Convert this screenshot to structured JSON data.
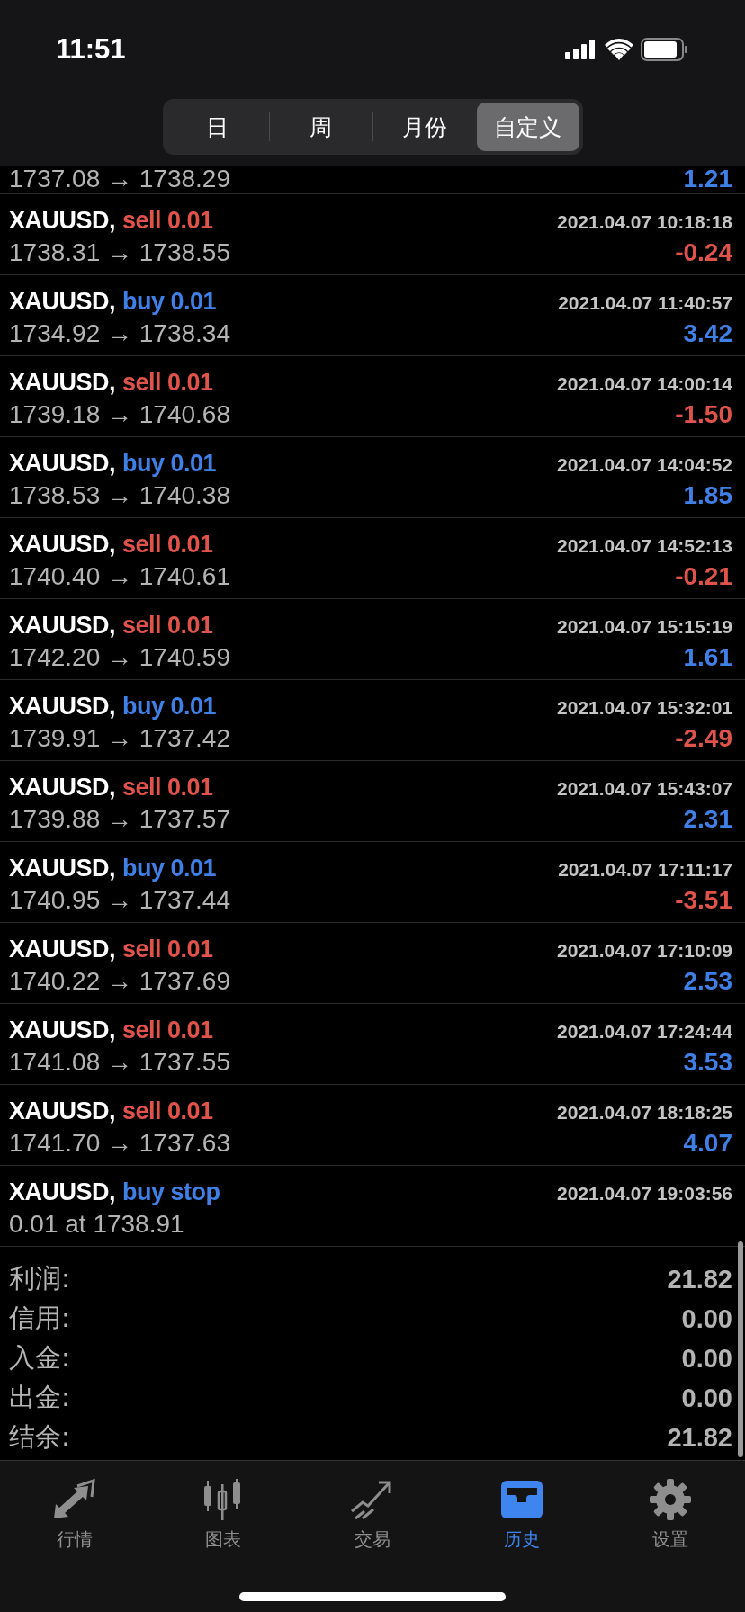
{
  "status_bar": {
    "time": "11:51"
  },
  "period_tabs": [
    {
      "label": "日",
      "selected": false
    },
    {
      "label": "周",
      "selected": false
    },
    {
      "label": "月份",
      "selected": false
    },
    {
      "label": "自定义",
      "selected": true
    }
  ],
  "partial_row": {
    "prices": "1737.08 → 1738.29",
    "profit": "1.21",
    "color": "#3f80e6"
  },
  "trades": [
    {
      "symbol": "XAUUSD,",
      "side": "sell 0.01",
      "kind": "sell",
      "time": "2021.04.07 10:18:18",
      "prices": "1738.31 → 1738.55",
      "profit": "-0.24",
      "color": "#e0534a"
    },
    {
      "symbol": "XAUUSD,",
      "side": "buy 0.01",
      "kind": "buy",
      "time": "2021.04.07 11:40:57",
      "prices": "1734.92 → 1738.34",
      "profit": "3.42",
      "color": "#3f80e6"
    },
    {
      "symbol": "XAUUSD,",
      "side": "sell 0.01",
      "kind": "sell",
      "time": "2021.04.07 14:00:14",
      "prices": "1739.18 → 1740.68",
      "profit": "-1.50",
      "color": "#e0534a"
    },
    {
      "symbol": "XAUUSD,",
      "side": "buy 0.01",
      "kind": "buy",
      "time": "2021.04.07 14:04:52",
      "prices": "1738.53 → 1740.38",
      "profit": "1.85",
      "color": "#3f80e6"
    },
    {
      "symbol": "XAUUSD,",
      "side": "sell 0.01",
      "kind": "sell",
      "time": "2021.04.07 14:52:13",
      "prices": "1740.40 → 1740.61",
      "profit": "-0.21",
      "color": "#e0534a"
    },
    {
      "symbol": "XAUUSD,",
      "side": "sell 0.01",
      "kind": "sell",
      "time": "2021.04.07 15:15:19",
      "prices": "1742.20 → 1740.59",
      "profit": "1.61",
      "color": "#3f80e6"
    },
    {
      "symbol": "XAUUSD,",
      "side": "buy 0.01",
      "kind": "buy",
      "time": "2021.04.07 15:32:01",
      "prices": "1739.91 → 1737.42",
      "profit": "-2.49",
      "color": "#e0534a"
    },
    {
      "symbol": "XAUUSD,",
      "side": "sell 0.01",
      "kind": "sell",
      "time": "2021.04.07 15:43:07",
      "prices": "1739.88 → 1737.57",
      "profit": "2.31",
      "color": "#3f80e6"
    },
    {
      "symbol": "XAUUSD,",
      "side": "buy 0.01",
      "kind": "buy",
      "time": "2021.04.07 17:11:17",
      "prices": "1740.95 → 1737.44",
      "profit": "-3.51",
      "color": "#e0534a"
    },
    {
      "symbol": "XAUUSD,",
      "side": "sell 0.01",
      "kind": "sell",
      "time": "2021.04.07 17:10:09",
      "prices": "1740.22 → 1737.69",
      "profit": "2.53",
      "color": "#3f80e6"
    },
    {
      "symbol": "XAUUSD,",
      "side": "sell 0.01",
      "kind": "sell",
      "time": "2021.04.07 17:24:44",
      "prices": "1741.08 → 1737.55",
      "profit": "3.53",
      "color": "#3f80e6"
    },
    {
      "symbol": "XAUUSD,",
      "side": "sell 0.01",
      "kind": "sell",
      "time": "2021.04.07 18:18:25",
      "prices": "1741.70 → 1737.63",
      "profit": "4.07",
      "color": "#3f80e6"
    },
    {
      "symbol": "XAUUSD,",
      "side": "buy stop",
      "kind": "buy",
      "time": "2021.04.07 19:03:56",
      "prices": "0.01 at 1738.91"
    }
  ],
  "summary": [
    {
      "label": "利润:",
      "value": "21.82"
    },
    {
      "label": "信用:",
      "value": "0.00"
    },
    {
      "label": "入金:",
      "value": "0.00"
    },
    {
      "label": "出金:",
      "value": "0.00"
    },
    {
      "label": "结余:",
      "value": "21.82"
    }
  ],
  "nav_tabs": [
    {
      "label": "行情",
      "selected": false
    },
    {
      "label": "图表",
      "selected": false
    },
    {
      "label": "交易",
      "selected": false
    },
    {
      "label": "历史",
      "selected": true
    },
    {
      "label": "设置",
      "selected": false
    }
  ]
}
